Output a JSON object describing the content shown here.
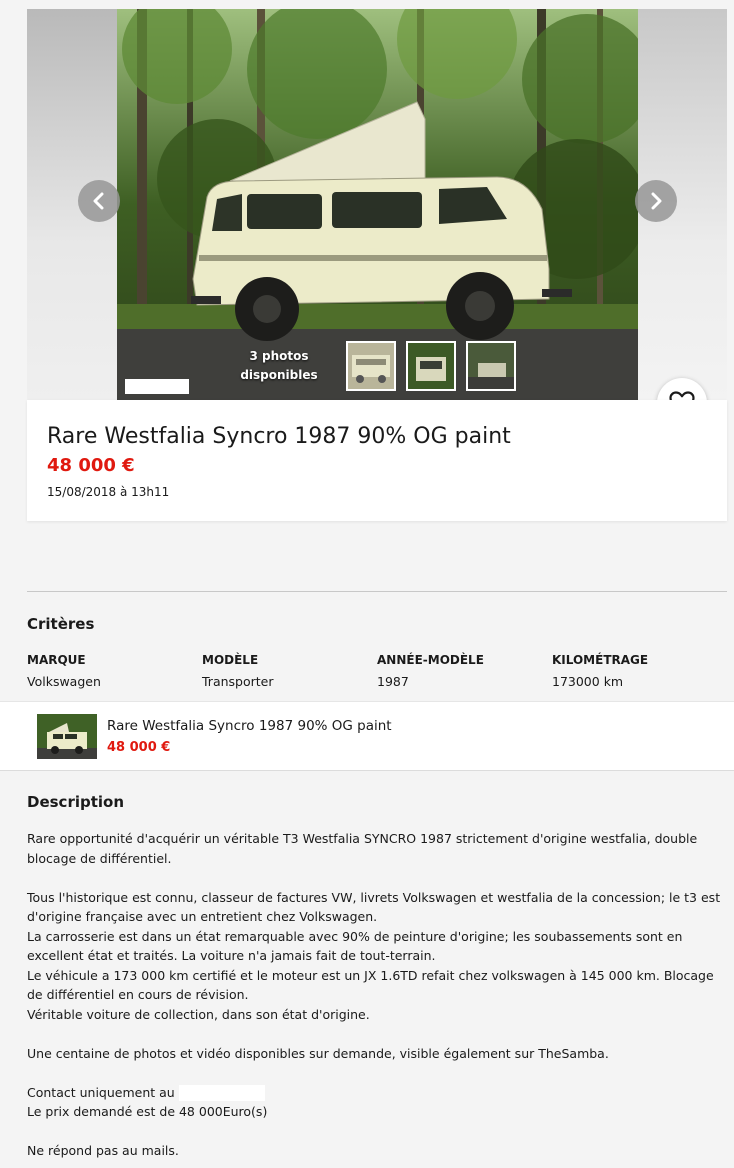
{
  "gallery": {
    "photo_count_label": "3 photos disponibles",
    "prev_icon": "chevron-left-icon",
    "next_icon": "chevron-right-icon",
    "favorite_icon": "heart-icon"
  },
  "ad": {
    "title": "Rare Westfalia Syncro 1987 90% OG paint",
    "price": "48 000 €",
    "date": "15/08/2018 à 13h11"
  },
  "criteria": {
    "heading": "Critères",
    "items": [
      {
        "label": "MARQUE",
        "value": "Volkswagen"
      },
      {
        "label": "MODÈLE",
        "value": "Transporter"
      },
      {
        "label": "ANNÉE-MODÈLE",
        "value": "1987"
      },
      {
        "label": "KILOMÉTRAGE",
        "value": "173000 km"
      }
    ]
  },
  "summary": {
    "title": "Rare Westfalia Syncro 1987 90% OG paint",
    "price": "48 000 €"
  },
  "description": {
    "heading": "Description",
    "p1": "Rare opportunité d'acquérir un véritable T3 Westfalia SYNCRO 1987 strictement d'origine westfalia, double blocage de différentiel.",
    "p2": "Tous l'historique est connu, classeur de factures VW, livrets Volkswagen et westfalia de la concession; le t3 est d'origine française avec un entretient chez Volkswagen.",
    "p3": "La carrosserie est dans un état remarquable avec 90% de peinture d'origine; les soubassements sont en excellent état et traités. La voiture n'a jamais fait de tout-terrain.",
    "p4": "Le véhicule a 173 000 km certifié et le moteur est un JX 1.6TD refait chez volkswagen à 145 000 km. Blocage de différentiel en cours de révision.",
    "p5": "Véritable voiture de collection, dans son état d'origine.",
    "p6": "Une centaine de photos et vidéo disponibles sur demande, visible également sur TheSamba.",
    "p7": "Contact uniquement au",
    "p8": "Le prix demandé est de 48 000Euro(s)",
    "p9": "Ne répond pas au mails."
  },
  "colors": {
    "price": "#e0190f",
    "van_body": "#ecebc9",
    "forest": "#3b5a22"
  }
}
